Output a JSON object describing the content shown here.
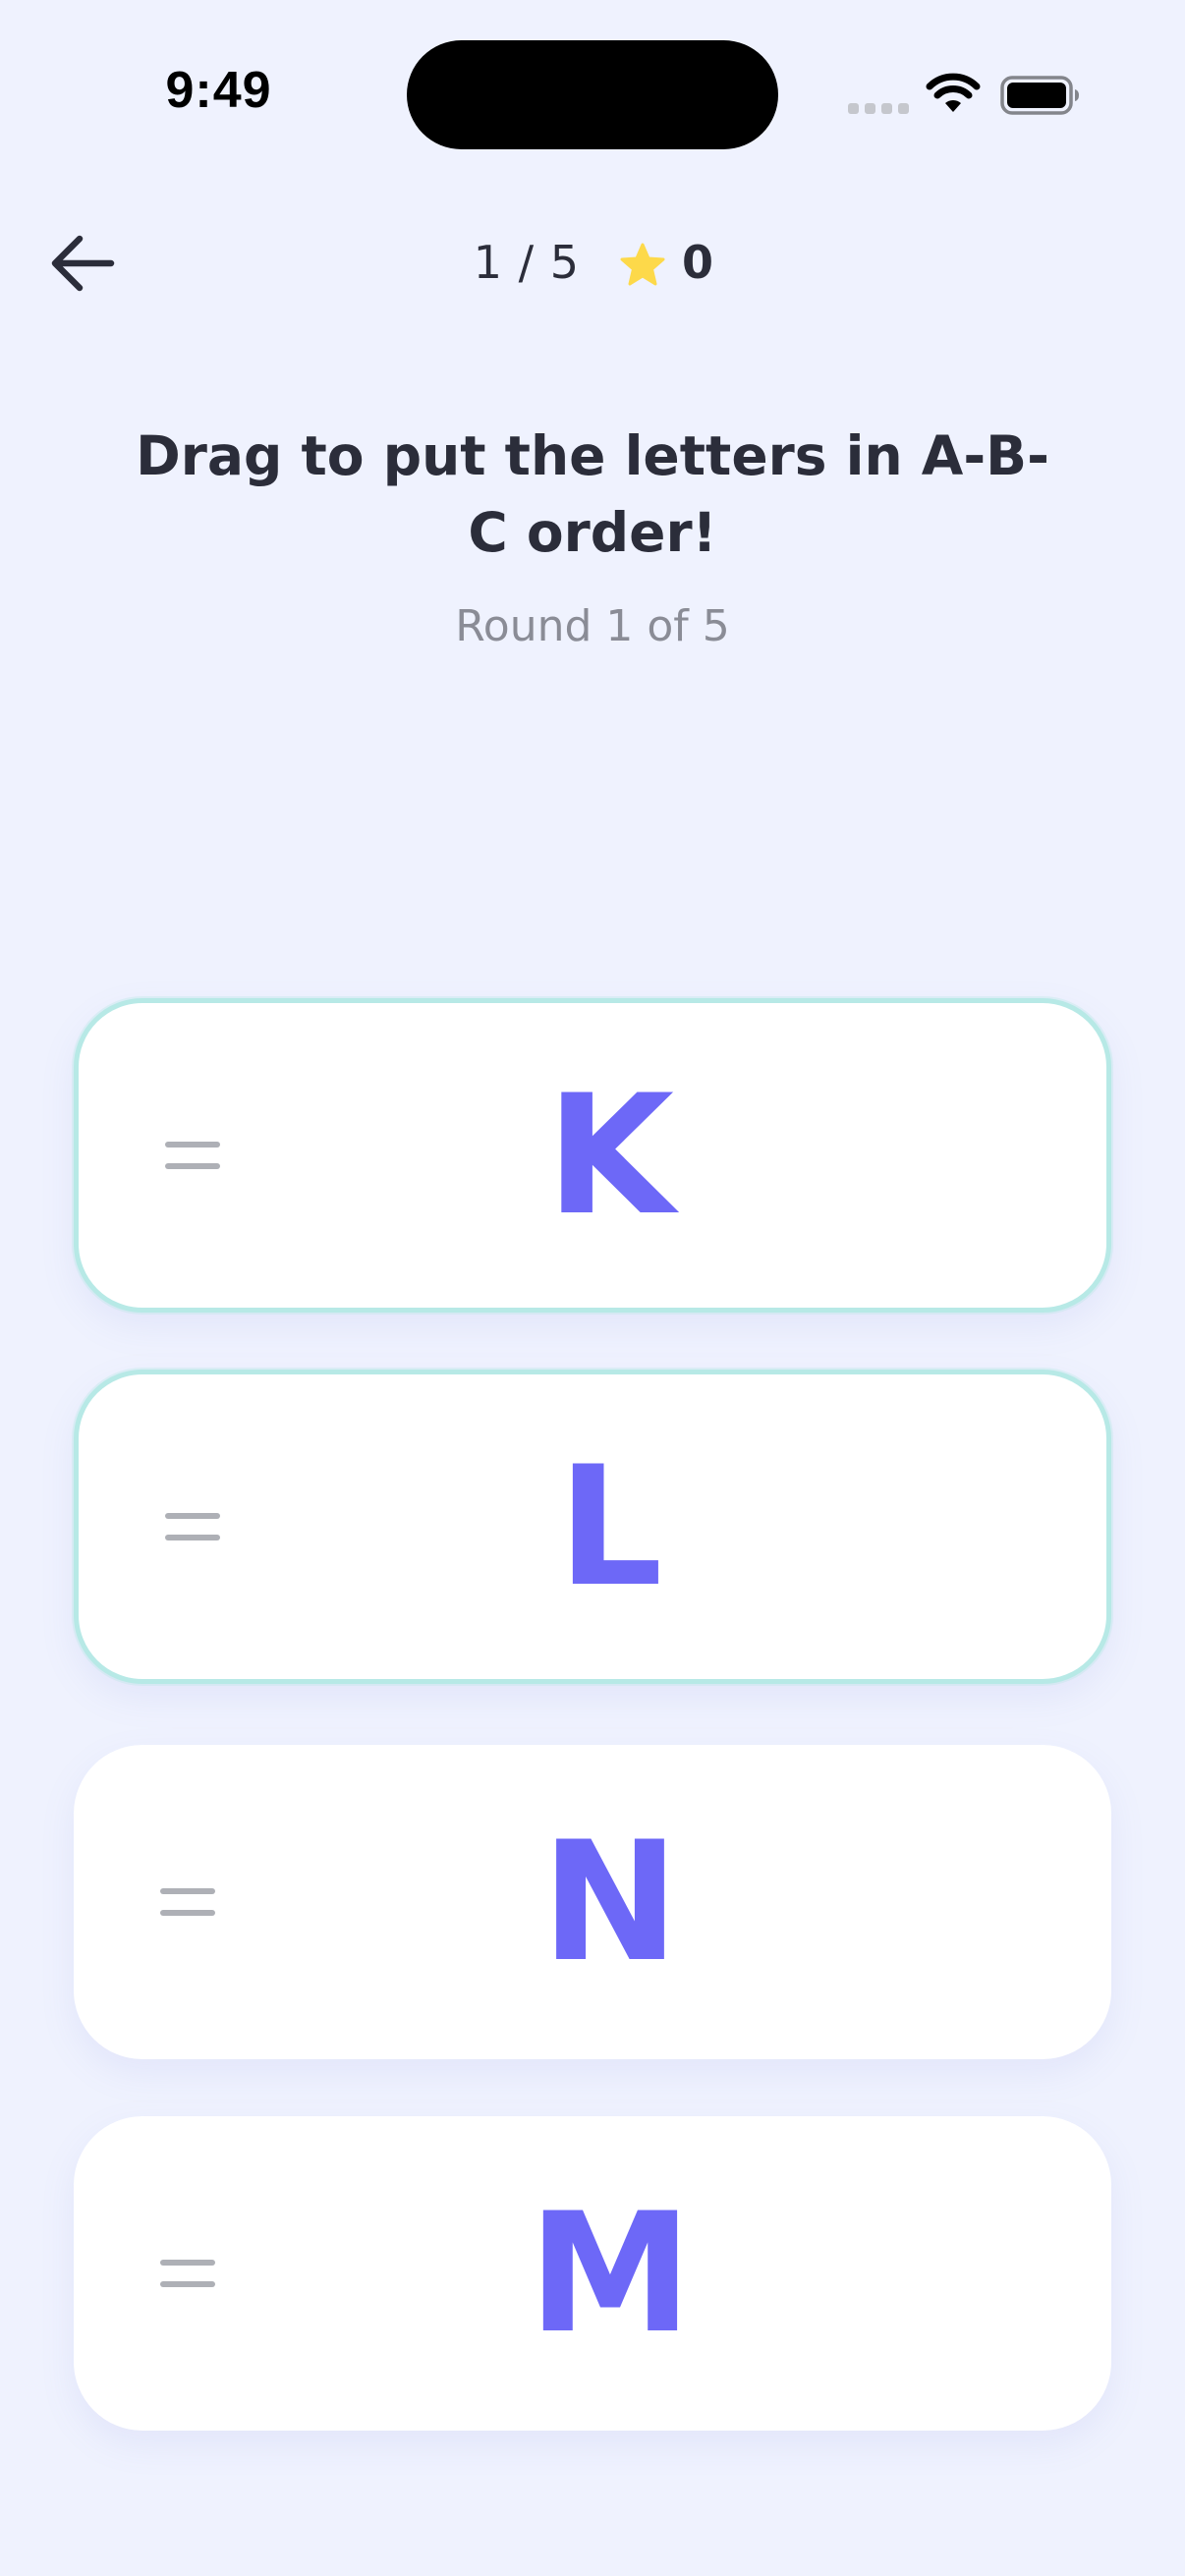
{
  "status_bar": {
    "time": "9:49"
  },
  "header": {
    "progress": "1 / 5",
    "score": "0",
    "icons": {
      "back": "arrow-left-icon",
      "score": "star-icon"
    }
  },
  "game": {
    "instruction": "Drag to put the letters in A-B-C order!",
    "round_label": "Round 1 of 5",
    "cards": [
      {
        "letter": "K",
        "state": "correct"
      },
      {
        "letter": "L",
        "state": "correct"
      },
      {
        "letter": "N",
        "state": "default"
      },
      {
        "letter": "M",
        "state": "default"
      }
    ]
  },
  "colors": {
    "background": "#eff2fe",
    "letter": "#6d68f7",
    "correct_border": "#b7e9e6",
    "star": "#fdd94a",
    "text": "#2b2d3a",
    "muted": "#8a8c96"
  }
}
